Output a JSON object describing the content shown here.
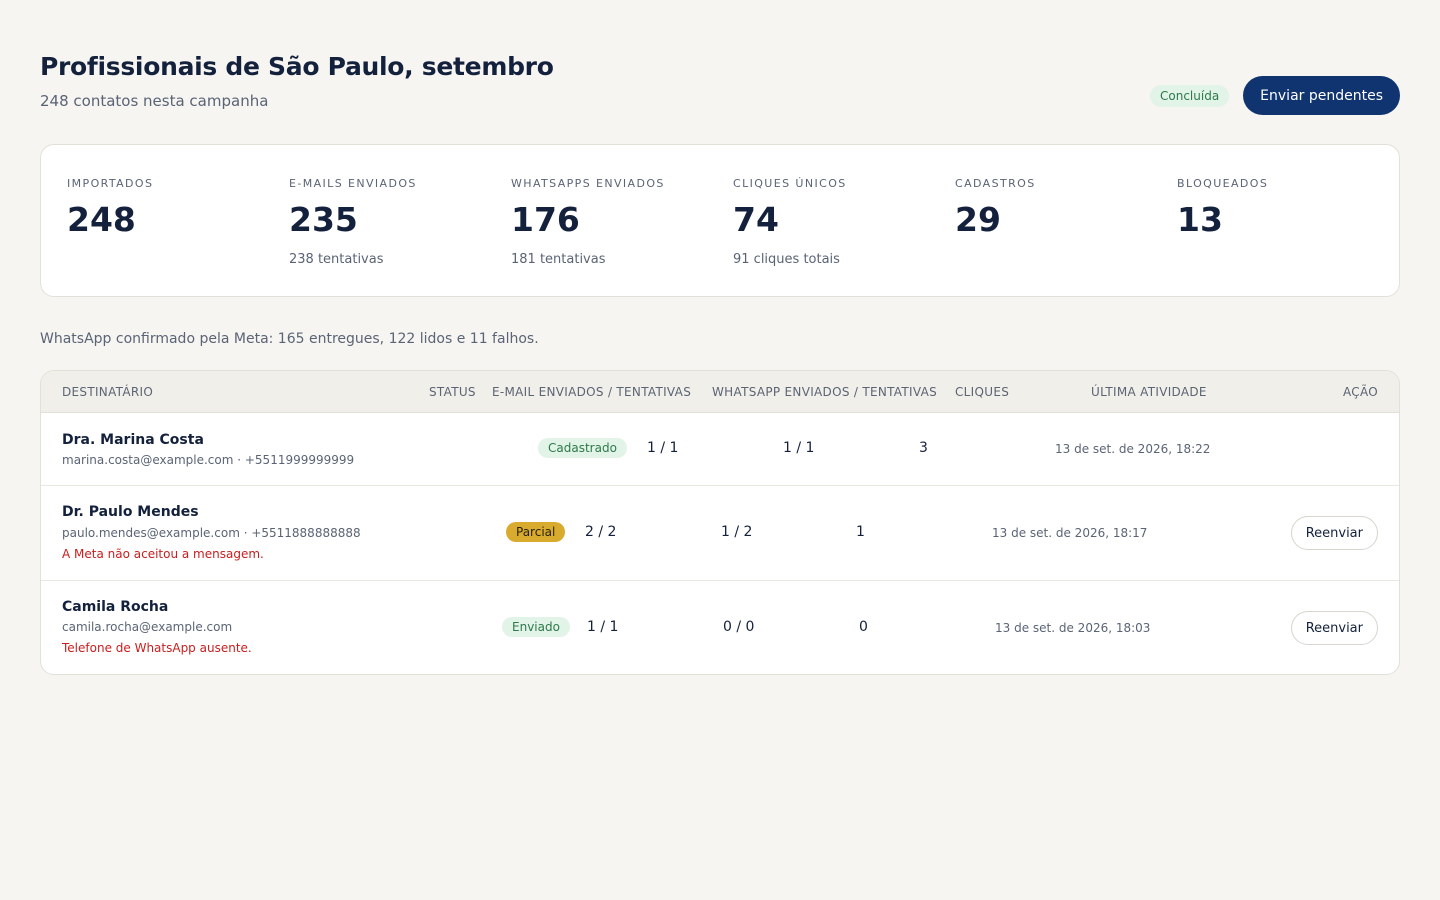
{
  "header": {
    "title": "Profissionais de São Paulo, setembro",
    "subtitle": "248 contatos nesta campanha",
    "status_badge": "Concluída",
    "primary_button": "Enviar pendentes"
  },
  "stats": [
    {
      "label": "IMPORTADOS",
      "value": "248",
      "sub": ""
    },
    {
      "label": "E-MAILS ENVIADOS",
      "value": "235",
      "sub": "238 tentativas"
    },
    {
      "label": "WHATSAPPS ENVIADOS",
      "value": "176",
      "sub": "181 tentativas"
    },
    {
      "label": "CLIQUES ÚNICOS",
      "value": "74",
      "sub": "91 cliques totais"
    },
    {
      "label": "CADASTROS",
      "value": "29",
      "sub": ""
    },
    {
      "label": "BLOQUEADOS",
      "value": "13",
      "sub": ""
    }
  ],
  "meta_note": "WhatsApp confirmado pela Meta: 165 entregues, 122 lidos e 11 falhos.",
  "table": {
    "headers": {
      "recipient": "DESTINATÁRIO",
      "status": "STATUS",
      "email": "E-MAIL ENVIADOS / TENTATIVAS",
      "whatsapp": "WHATSAPP ENVIADOS / TENTATIVAS",
      "clicks": "CLIQUES",
      "last_activity": "ÚLTIMA ATIVIDADE",
      "action": "AÇÃO"
    },
    "rows": [
      {
        "name": "Dra. Marina Costa",
        "contact": "marina.costa@example.com · +5511999999999",
        "error": "",
        "status": "Cadastrado",
        "email": "1 / 1",
        "whatsapp": "1 / 1",
        "clicks": "3",
        "last_activity": "13 de set. de 2026, 18:22",
        "action": ""
      },
      {
        "name": "Dr. Paulo Mendes",
        "contact": "paulo.mendes@example.com · +5511888888888",
        "error": "A Meta não aceitou a mensagem.",
        "status": "Parcial",
        "email": "2 / 2",
        "whatsapp": "1 / 2",
        "clicks": "1",
        "last_activity": "13 de set. de 2026, 18:17",
        "action": "Reenviar"
      },
      {
        "name": "Camila Rocha",
        "contact": "camila.rocha@example.com",
        "error": "Telefone de WhatsApp ausente.",
        "status": "Enviado",
        "email": "1 / 1",
        "whatsapp": "0 / 0",
        "clicks": "0",
        "last_activity": "13 de set. de 2026, 18:03",
        "action": "Reenviar"
      }
    ]
  },
  "colors": {
    "background": "#f6f5f1",
    "primary": "#0f3470",
    "success_bg": "#e2f3e8",
    "success_text": "#2e7a4a",
    "partial_bg": "#d8ab2e",
    "error_text": "#c81e1e"
  }
}
